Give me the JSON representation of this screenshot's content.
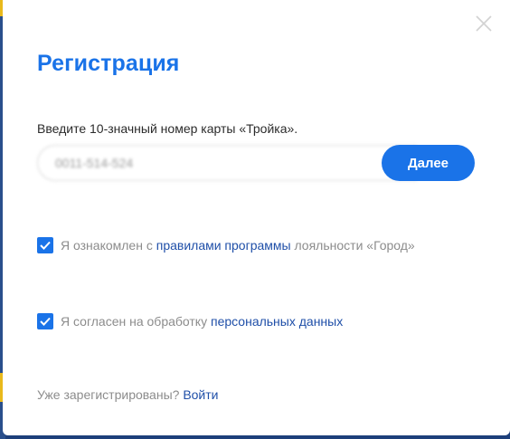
{
  "modal": {
    "title": "Регистрация",
    "prompt": "Введите 10-значный номер карты «Тройка».",
    "card_input": {
      "value": "0011-514-524",
      "placeholder": ""
    },
    "next_label": "Далее",
    "close_icon": "close-icon"
  },
  "consents": [
    {
      "checked": true,
      "pre": "Я ознакомлен с ",
      "link": "правилами программы",
      "post": " лояльности «Город»"
    },
    {
      "checked": true,
      "pre": "Я согласен на обработку ",
      "link": "персональных данных",
      "post": ""
    }
  ],
  "login": {
    "prompt": "Уже зарегистрированы?",
    "link": "Войти"
  },
  "colors": {
    "accent": "#1a73e8",
    "link": "#1f4fa8",
    "muted_text": "#8c8c8c",
    "backdrop": "#1d3f7a"
  }
}
